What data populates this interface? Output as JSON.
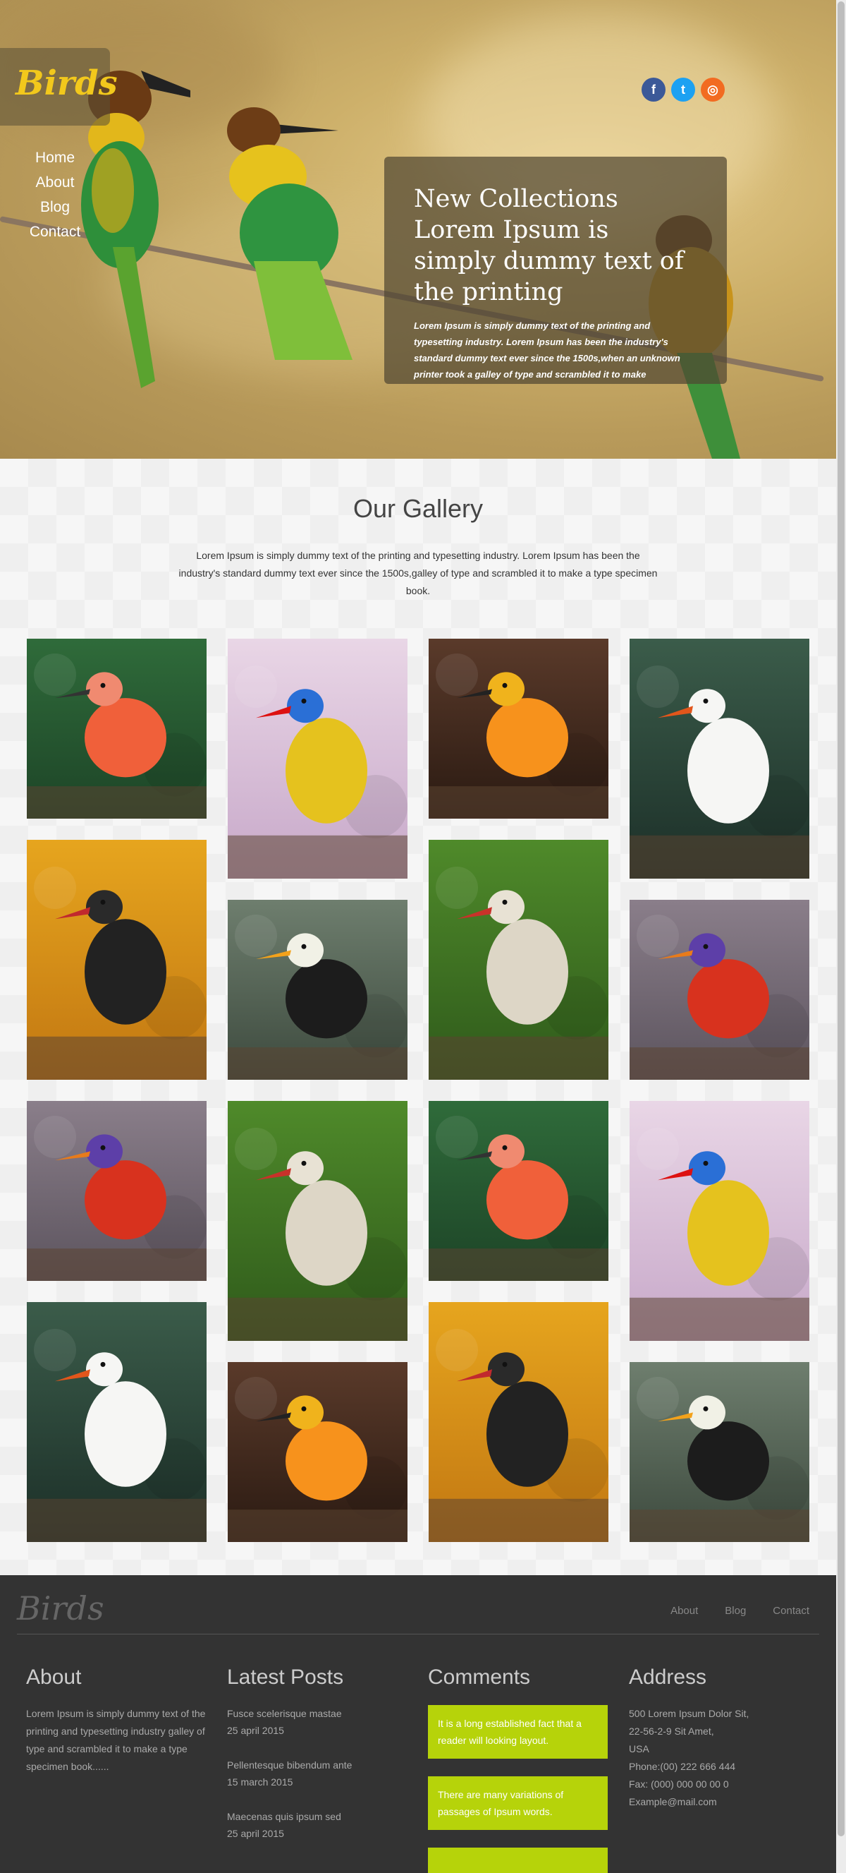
{
  "brand": {
    "logo": "Birds",
    "accent": "#f2c81c"
  },
  "nav": [
    "Home",
    "About",
    "Blog",
    "Contact"
  ],
  "social": [
    {
      "icon": "facebook-icon",
      "glyph": "f",
      "color": "#3b5998"
    },
    {
      "icon": "twitter-icon",
      "glyph": "t",
      "color": "#1da1f2"
    },
    {
      "icon": "dribbble-icon",
      "glyph": "◎",
      "color": "#f26b21"
    }
  ],
  "hero": {
    "title": "New Collections Lorem Ipsum is simply dummy text of the printing",
    "text": "Lorem Ipsum is simply dummy text of the printing and typesetting industry. Lorem Ipsum has been the industry's standard dummy text ever since the 1500s,when an unknown printer took a galley of type and scrambled it to make"
  },
  "gallery": {
    "title": "Our Gallery",
    "intro": "Lorem Ipsum is simply dummy text of the printing and typesetting industry. Lorem Ipsum has been the industry's standard dummy text ever since the 1500s,galley of type and scrambled it to make a type specimen book.",
    "photos": [
      "ibis",
      "parrot",
      "parakeets",
      "swan",
      "blackbird",
      "toucan",
      "stork",
      "lorikeet",
      "lorikeet",
      "stork",
      "ibis",
      "parrot",
      "swan",
      "parakeets",
      "blackbird",
      "toucan"
    ]
  },
  "footer": {
    "logo": "Birds",
    "nav": [
      "About",
      "Blog",
      "Contact"
    ],
    "about": {
      "title": "About",
      "text": "Lorem Ipsum is simply dummy text of the printing and typesetting industry galley of type and scrambled it to make a type specimen book......"
    },
    "posts": {
      "title": "Latest Posts",
      "items": [
        {
          "title": "Fusce scelerisque mastae",
          "date": "25 april 2015"
        },
        {
          "title": "Pellentesque bibendum ante",
          "date": "15 march 2015"
        },
        {
          "title": "Maecenas quis ipsum sed",
          "date": "25 april 2015"
        }
      ]
    },
    "comments": {
      "title": "Comments",
      "items": [
        "It is a long established fact that a reader will looking layout.",
        "There are many variations of passages of Ipsum words.",
        ""
      ]
    },
    "address": {
      "title": "Address",
      "lines": [
        "500 Lorem Ipsum Dolor Sit,",
        "22-56-2-9 Sit Amet,",
        "USA",
        "Phone:(00) 222 666 444",
        "Fax: (000) 000 00 00 0",
        "Example@mail.com"
      ]
    }
  }
}
